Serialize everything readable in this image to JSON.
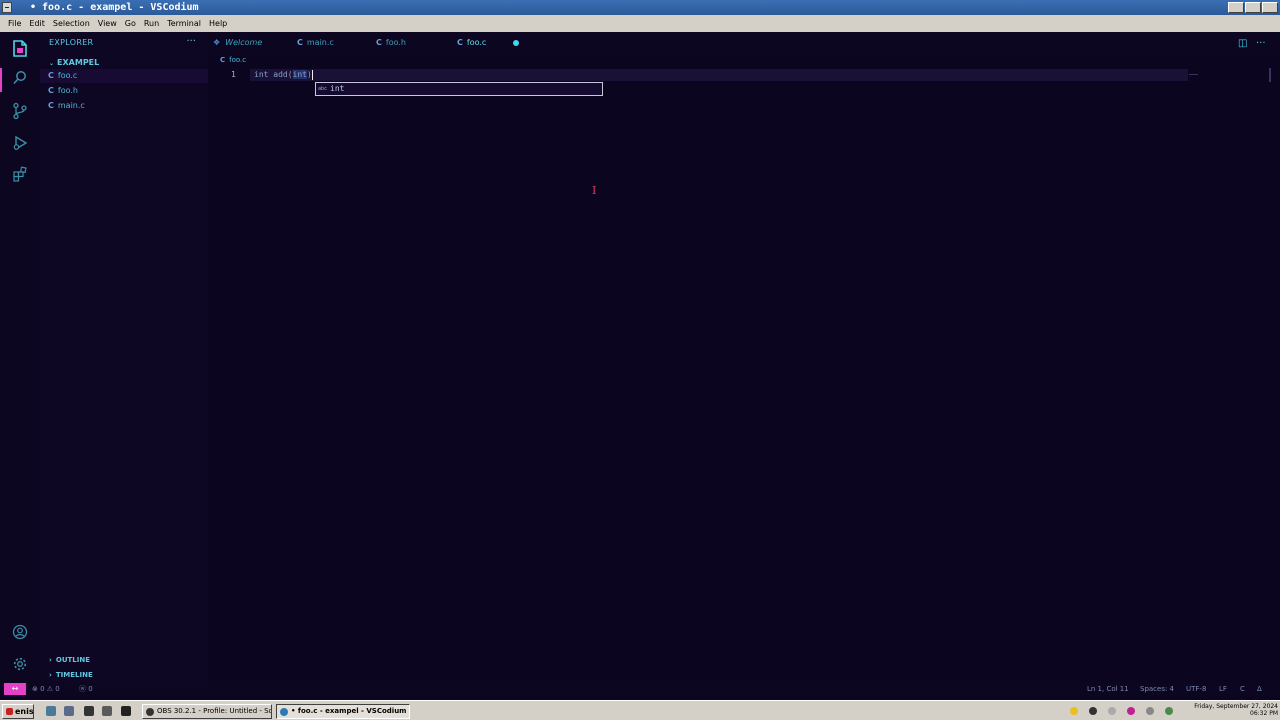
{
  "window": {
    "title": "• foo.c - exampel - VSCodium"
  },
  "menubar": {
    "items": [
      "File",
      "Edit",
      "Selection",
      "View",
      "Go",
      "Run",
      "Terminal",
      "Help"
    ]
  },
  "activitybar": {
    "icons": [
      "files-icon",
      "search-icon",
      "source-control-icon",
      "run-debug-icon",
      "extensions-icon",
      "account-icon",
      "manage-gear-icon"
    ]
  },
  "sidebar": {
    "title": "EXPLORER",
    "more": "···",
    "folder": "EXAMPEL",
    "files": [
      {
        "icon": "C",
        "name": "foo.c"
      },
      {
        "icon": "C",
        "name": "foo.h"
      },
      {
        "icon": "C",
        "name": "main.c"
      }
    ],
    "outline": "OUTLINE",
    "timeline": "TIMELINE"
  },
  "tabs": [
    {
      "icon": "C",
      "label": "Welcome"
    },
    {
      "icon": "C",
      "label": "main.c"
    },
    {
      "icon": "C",
      "label": "foo.h"
    },
    {
      "icon": "C",
      "label": "foo.c"
    }
  ],
  "breadcrumb": {
    "icon": "C",
    "file": "foo.c"
  },
  "editor": {
    "line_number": "1",
    "code_before": "int add(",
    "code_selected": "int",
    "code_after": ")",
    "suggestion_kind": "abc",
    "suggestion": "int"
  },
  "statusbar": {
    "remote": "↔",
    "errors": "⊗ 0 ⚠ 0",
    "warnings": "ⓦ 0",
    "position": "Ln 1, Col 11",
    "spaces": "Spaces: 4",
    "encoding": "UTF-8",
    "eol": "LF",
    "language": "C",
    "bell": "Δ"
  },
  "taskbar": {
    "start": "enis",
    "tasks": [
      {
        "label": "OBS 30.2.1 - Profile: Untitled - Sc..."
      },
      {
        "label": "• foo.c - exampel - VSCodium"
      }
    ],
    "clock_date": "Friday, September 27, 2024",
    "clock_time": "06:32 PM"
  }
}
